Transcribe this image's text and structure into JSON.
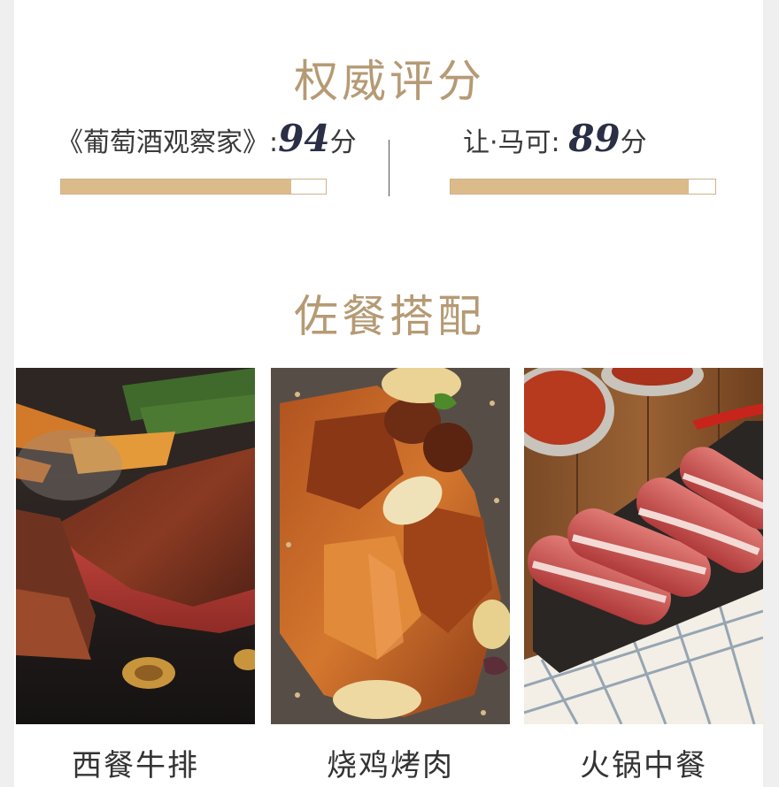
{
  "ratings_title": "权威评分",
  "ratings": [
    {
      "source": "《葡萄酒观察家》",
      "separator": ":",
      "score": "94",
      "unit": "分",
      "fill_fraction": 0.87
    },
    {
      "source": "让·马可:",
      "separator": "",
      "score": "89",
      "unit": "分",
      "fill_fraction": 0.9
    }
  ],
  "pairing_title": "佐餐搭配",
  "pairings": [
    {
      "label": "西餐牛排",
      "icon": "steak-image"
    },
    {
      "label": "烧鸡烤肉",
      "icon": "roast-chicken-image"
    },
    {
      "label": "火锅中餐",
      "icon": "hotpot-beef-image"
    }
  ],
  "colors": {
    "accent": "#b59a74",
    "bar_fill": "#dcbb8a",
    "score": "#2a2f45"
  }
}
